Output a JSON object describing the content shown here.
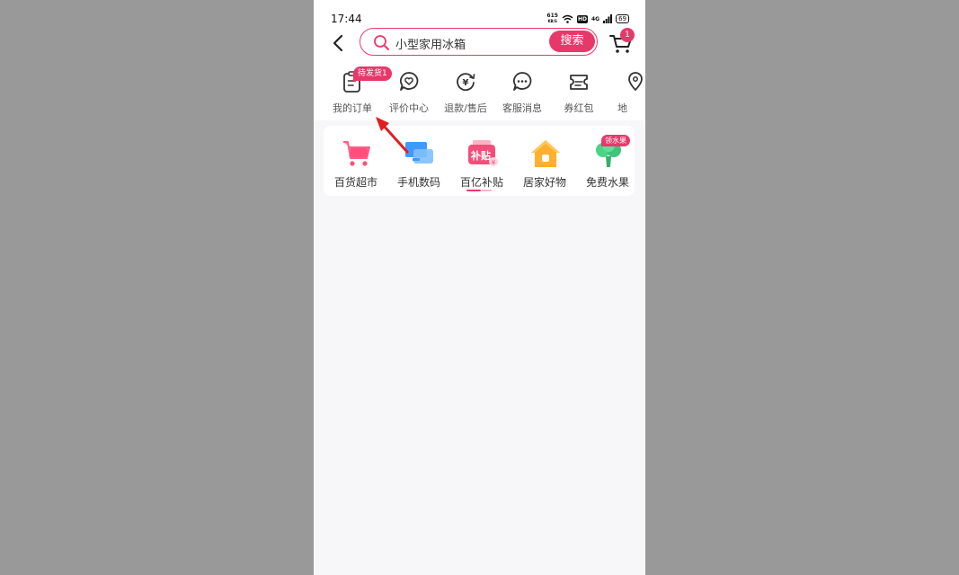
{
  "status_bar": {
    "time": "17:44",
    "net_speed_top": "615",
    "net_speed_unit": "KB/S",
    "hd": "HD",
    "signal": "4G",
    "battery": "69"
  },
  "search": {
    "query": "小型家用冰箱",
    "button_label": "搜索"
  },
  "cart": {
    "badge": "1"
  },
  "quick_links": [
    {
      "label": "我的订单",
      "icon": "order-icon"
    },
    {
      "label": "评价中心",
      "icon": "review-icon"
    },
    {
      "label": "退款/售后",
      "icon": "refund-icon"
    },
    {
      "label": "客服消息",
      "icon": "chat-icon"
    },
    {
      "label": "券红包",
      "icon": "coupon-icon"
    },
    {
      "label": "地",
      "icon": "location-icon"
    }
  ],
  "pending_badge": "待发货1",
  "categories": [
    {
      "label": "百货超市",
      "icon": "cart-icon"
    },
    {
      "label": "手机数码",
      "icon": "devices-icon"
    },
    {
      "label": "百亿补贴",
      "icon": "subsidy-icon"
    },
    {
      "label": "居家好物",
      "icon": "home-icon"
    },
    {
      "label": "免费水果",
      "icon": "tree-icon"
    }
  ],
  "subsidy_icon_text": "补贴",
  "fruit_badge": "领水果",
  "colors": {
    "accent": "#e8386a",
    "page_bg": "#f7f7f9",
    "outer_bg": "#999999"
  }
}
